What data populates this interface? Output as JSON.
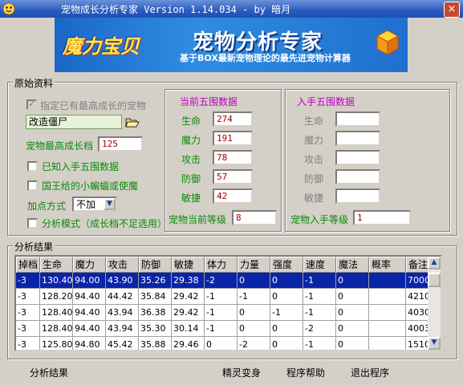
{
  "window": {
    "title": "宠物成长分析专家 Version 1.14.034 - by 暗月",
    "close_symbol": "×"
  },
  "banner": {
    "logo_text": "魔力宝贝",
    "headline": "宠物分析专家",
    "tagline": "基于BOX最新宠物理论的最先进宠物计算器",
    "logo_icon": "cube-icon"
  },
  "original": {
    "legend": "原始资料",
    "designate_max_label": "指定已有最高成长的宠物",
    "designate_max_checked": true,
    "pet_name": "改造僵尸",
    "open_icon": "folder-open-icon",
    "max_growth_label": "宠物最高成长档",
    "max_growth_value": "125",
    "known_stats_label": "已知入手五围数据",
    "known_stats_checked": false,
    "king_bat_label": "国王给的小蝙蝠或使魔",
    "king_bat_checked": false,
    "add_method_label": "加点方式",
    "add_method_value": "不加",
    "analysis_mode_label": "分析模式（成长档不足选用）",
    "analysis_mode_checked": false
  },
  "current": {
    "title": "当前五围数据",
    "stats": [
      {
        "label": "生命",
        "value": "274"
      },
      {
        "label": "魔力",
        "value": "191"
      },
      {
        "label": "攻击",
        "value": "78"
      },
      {
        "label": "防御",
        "value": "57"
      },
      {
        "label": "敏捷",
        "value": "42"
      }
    ],
    "level_label": "宠物当前等级",
    "level_value": "8"
  },
  "acquired": {
    "title": "入手五围数据",
    "stats": [
      {
        "label": "生命",
        "value": ""
      },
      {
        "label": "魔力",
        "value": ""
      },
      {
        "label": "攻击",
        "value": ""
      },
      {
        "label": "防御",
        "value": ""
      },
      {
        "label": "敏捷",
        "value": ""
      }
    ],
    "level_label": "宠物入手等级",
    "level_value": "1"
  },
  "results": {
    "legend": "分析结果",
    "columns": [
      "掉档",
      "生命",
      "魔力",
      "攻击",
      "防御",
      "敏捷",
      "体力",
      "力量",
      "强度",
      "速度",
      "魔法",
      "概率",
      "备注"
    ],
    "rows": [
      [
        "-3",
        "130.40",
        "94.00",
        "43.90",
        "35.26",
        "29.38",
        "-2",
        "0",
        "0",
        "-1",
        "0",
        "",
        "7000"
      ],
      [
        "-3",
        "128.20",
        "94.40",
        "44.42",
        "35.84",
        "29.42",
        "-1",
        "-1",
        "0",
        "-1",
        "0",
        "",
        "4210"
      ],
      [
        "-3",
        "128.40",
        "94.40",
        "43.94",
        "36.38",
        "29.42",
        "-1",
        "0",
        "-1",
        "-1",
        "0",
        "",
        "4030"
      ],
      [
        "-3",
        "128.40",
        "94.40",
        "43.94",
        "35.30",
        "30.14",
        "-1",
        "0",
        "0",
        "-2",
        "0",
        "",
        "4003"
      ],
      [
        "-3",
        "125.80",
        "94.80",
        "45.42",
        "35.88",
        "29.46",
        "0",
        "-2",
        "0",
        "-1",
        "0",
        "",
        "1510"
      ]
    ],
    "selected_row": 0
  },
  "footer": {
    "analyze": "分析结果",
    "elf": "精灵变身",
    "help": "程序帮助",
    "exit": "退出程序"
  }
}
